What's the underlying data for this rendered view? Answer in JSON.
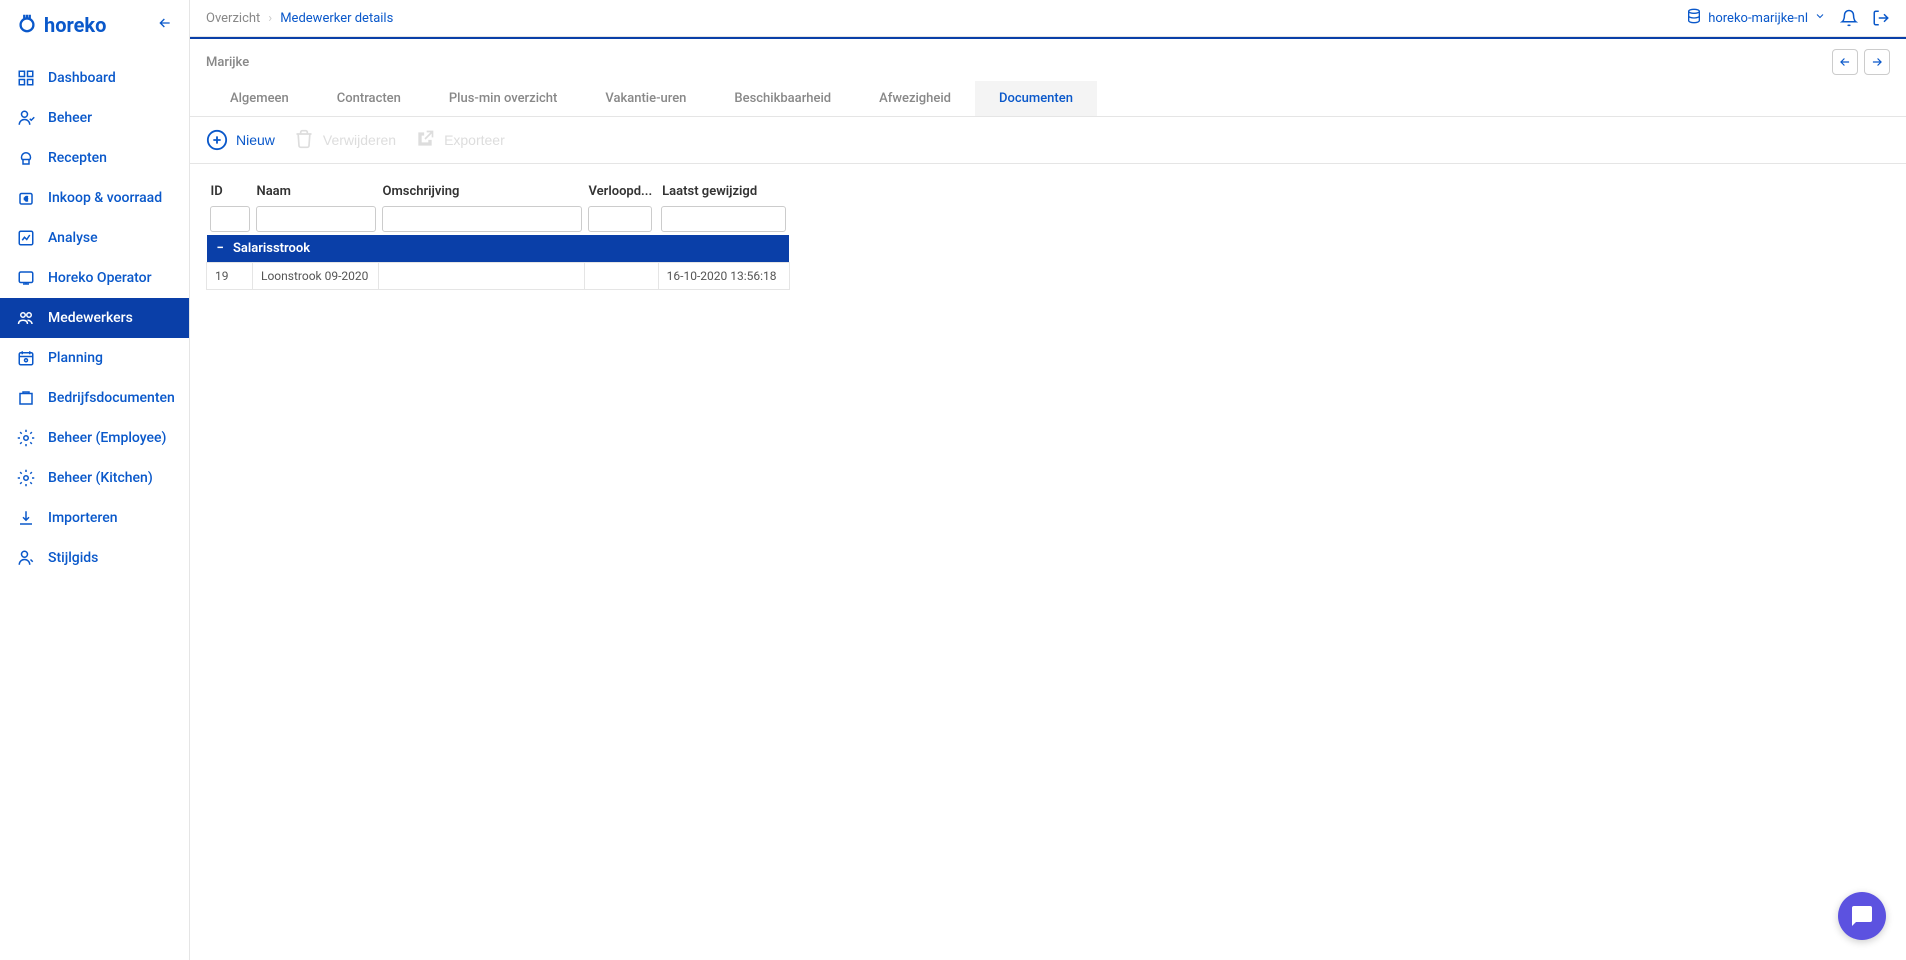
{
  "logo": {
    "text": "horeko"
  },
  "sidebar": {
    "items": [
      {
        "label": "Dashboard"
      },
      {
        "label": "Beheer"
      },
      {
        "label": "Recepten"
      },
      {
        "label": "Inkoop & voorraad"
      },
      {
        "label": "Analyse"
      },
      {
        "label": "Horeko Operator"
      },
      {
        "label": "Medewerkers"
      },
      {
        "label": "Planning"
      },
      {
        "label": "Bedrijfsdocumenten"
      },
      {
        "label": "Beheer (Employee)"
      },
      {
        "label": "Beheer (Kitchen)"
      },
      {
        "label": "Importeren"
      },
      {
        "label": "Stijlgids"
      }
    ]
  },
  "breadcrumb": {
    "items": [
      {
        "label": "Overzicht"
      },
      {
        "label": "Medewerker details"
      }
    ]
  },
  "account": {
    "name": "horeko-marijke-nl"
  },
  "page": {
    "title": "Marijke"
  },
  "tabs": [
    {
      "label": "Algemeen"
    },
    {
      "label": "Contracten"
    },
    {
      "label": "Plus-min overzicht"
    },
    {
      "label": "Vakantie-uren"
    },
    {
      "label": "Beschikbaarheid"
    },
    {
      "label": "Afwezigheid"
    },
    {
      "label": "Documenten"
    }
  ],
  "toolbar": {
    "new": "Nieuw",
    "delete": "Verwijderen",
    "export": "Exporteer"
  },
  "table": {
    "headers": {
      "id": "ID",
      "name": "Naam",
      "description": "Omschrijving",
      "expires": "Verloopd...",
      "modified": "Laatst gewijzigd"
    },
    "group": {
      "name": "Salarisstrook"
    },
    "rows": [
      {
        "id": "19",
        "name": "Loonstrook 09-2020",
        "description": "",
        "expires": "",
        "modified": "16-10-2020 13:56:18"
      }
    ]
  }
}
